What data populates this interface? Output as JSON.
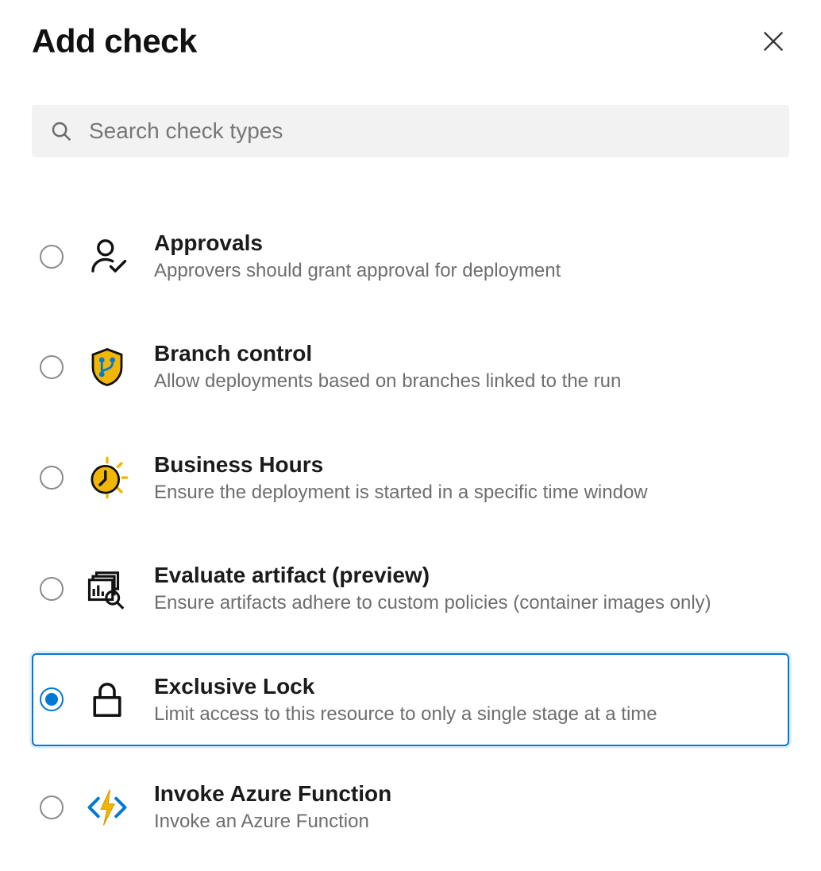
{
  "header": {
    "title": "Add check"
  },
  "search": {
    "placeholder": "Search check types"
  },
  "selected_index": 4,
  "items": [
    {
      "icon": "person-check-icon",
      "title": "Approvals",
      "desc": "Approvers should grant approval for deployment"
    },
    {
      "icon": "branch-shield-icon",
      "title": "Branch control",
      "desc": "Allow deployments based on branches linked to the run"
    },
    {
      "icon": "clock-sun-icon",
      "title": "Business Hours",
      "desc": "Ensure the deployment is started in a specific time window"
    },
    {
      "icon": "artifact-eval-icon",
      "title": "Evaluate artifact (preview)",
      "desc": "Ensure artifacts adhere to custom policies (container images only)"
    },
    {
      "icon": "lock-icon",
      "title": "Exclusive Lock",
      "desc": "Limit access to this resource to only a single stage at a time"
    },
    {
      "icon": "azure-function-icon",
      "title": "Invoke Azure Function",
      "desc": "Invoke an Azure Function"
    }
  ]
}
